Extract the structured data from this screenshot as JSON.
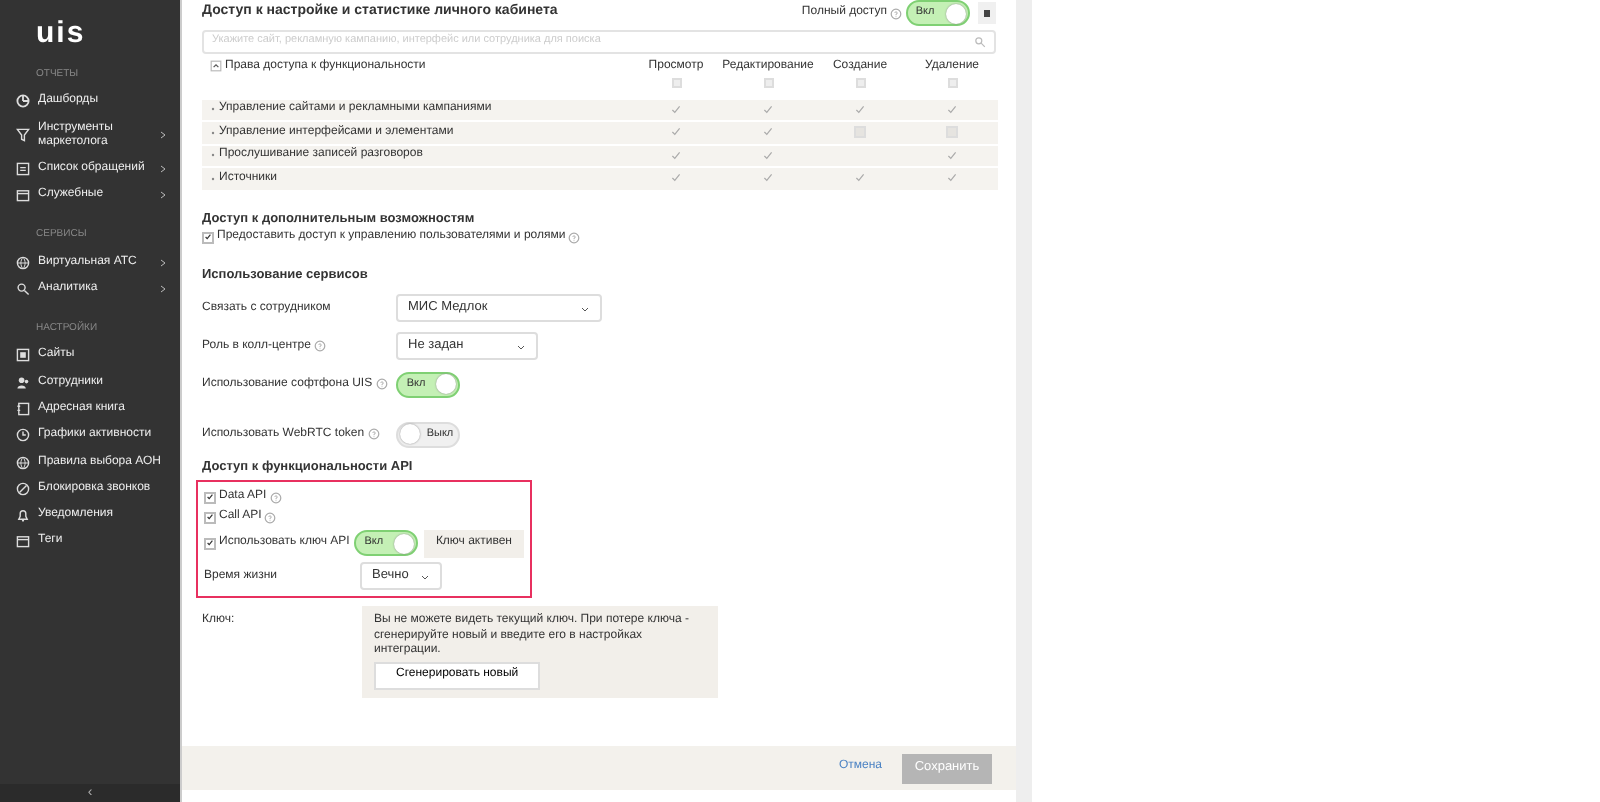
{
  "sidebar": {
    "logo": "uis",
    "sections": [
      {
        "title": "ОТЧЕТЫ",
        "items": [
          {
            "label": "Дашборды",
            "submenu": false
          },
          {
            "label": "Инструменты маркетолога",
            "submenu": true
          },
          {
            "label": "Список обращений",
            "submenu": true
          },
          {
            "label": "Служебные",
            "submenu": true
          }
        ]
      },
      {
        "title": "СЕРВИСЫ",
        "items": [
          {
            "label": "Виртуальная АТС",
            "submenu": true
          },
          {
            "label": "Аналитика",
            "submenu": true
          }
        ]
      },
      {
        "title": "НАСТРОЙКИ",
        "items": [
          {
            "label": "Сайты",
            "submenu": false
          },
          {
            "label": "Сотрудники",
            "submenu": false
          },
          {
            "label": "Адресная книга",
            "submenu": false
          },
          {
            "label": "Графики активности",
            "submenu": false
          },
          {
            "label": "Правила выбора АОН",
            "submenu": false
          },
          {
            "label": "Блокировка звонков",
            "submenu": false
          },
          {
            "label": "Уведомления",
            "submenu": false
          },
          {
            "label": "Теги",
            "submenu": false
          }
        ]
      }
    ],
    "collapse": "‹"
  },
  "access": {
    "title": "Доступ к настройке и статистике личного кабинета",
    "full_access_label": "Полный доступ",
    "full_access_toggle": {
      "on": true,
      "label": "Вкл"
    },
    "search": {
      "placeholder": "Укажите сайт, рекламную кампанию, интерфейс или сотрудника для поиска"
    },
    "table": {
      "first_column": "Права доступа к функциональности",
      "columns": [
        {
          "label": "Просмотр",
          "all_checked": false
        },
        {
          "label": "Редактирование",
          "all_checked": false
        },
        {
          "label": "Создание",
          "all_checked": false
        },
        {
          "label": "Удаление",
          "all_checked": false
        }
      ],
      "rows": [
        {
          "label": "Управление сайтами и рекламными кампаниями",
          "cells": [
            {
              "checked": true,
              "disabled": false
            },
            {
              "checked": true,
              "disabled": false
            },
            {
              "checked": true,
              "disabled": false
            },
            {
              "checked": true,
              "disabled": false
            }
          ]
        },
        {
          "label": "Управление интерфейсами и элементами",
          "cells": [
            {
              "checked": true,
              "disabled": false
            },
            {
              "checked": true,
              "disabled": false
            },
            {
              "checked": false,
              "disabled": true
            },
            {
              "checked": false,
              "disabled": true
            }
          ]
        },
        {
          "label": "Прослушивание записей разговоров",
          "cells": [
            {
              "checked": true,
              "disabled": false
            },
            {
              "checked": true,
              "disabled": false
            },
            {
              "checked": false,
              "disabled": false
            },
            {
              "checked": true,
              "disabled": false
            }
          ]
        },
        {
          "label": "Источники",
          "cells": [
            {
              "checked": true,
              "disabled": false
            },
            {
              "checked": true,
              "disabled": false
            },
            {
              "checked": true,
              "disabled": false
            },
            {
              "checked": true,
              "disabled": false
            }
          ]
        }
      ]
    }
  },
  "extra": {
    "title": "Доступ к дополнительным возможностям",
    "option": {
      "label": "Предоставить доступ к управлению пользователями и ролями",
      "checked": true
    }
  },
  "services": {
    "title": "Использование сервисов",
    "rows": [
      {
        "kind": "select",
        "label": "Связать с сотрудником",
        "help": false,
        "value": "МИС Медлок"
      },
      {
        "kind": "select",
        "label": "Роль в колл-центре",
        "help": true,
        "value": "Не задан"
      },
      {
        "kind": "toggle",
        "label": "Использование софтфона UIS",
        "help": true,
        "on": true,
        "toggle_label": "Вкл"
      },
      {
        "kind": "toggle",
        "label": "Использовать WebRTC token",
        "help": true,
        "on": false,
        "toggle_label": "Выкл"
      }
    ]
  },
  "api": {
    "title": "Доступ к функциональности API",
    "options": [
      {
        "label": "Data API",
        "checked": true,
        "help": true
      },
      {
        "label": "Call API",
        "checked": true,
        "help": true
      },
      {
        "label": "Использовать ключ API",
        "checked": true,
        "help": false,
        "toggle": {
          "on": true,
          "label": "Вкл"
        },
        "status": "Ключ активен"
      }
    ],
    "lifetime": {
      "label": "Время жизни",
      "value": "Вечно"
    },
    "key": {
      "label": "Ключ:",
      "note": "Вы не можете видеть текущий ключ. При потере ключа - сгенерируйте новый и введите его в настройках интеграции.",
      "button": "Сгенерировать новый"
    }
  },
  "footer": {
    "cancel": "Отмена",
    "save": "Сохранить",
    "save_disabled": true
  }
}
